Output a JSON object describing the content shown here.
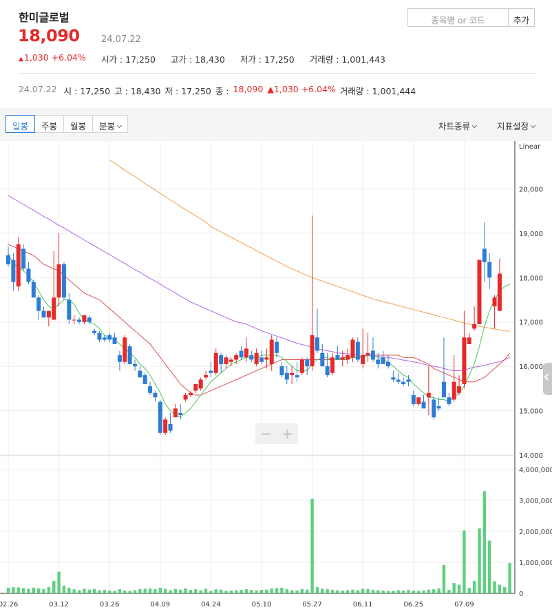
{
  "header": {
    "stock_name": "한미글로벌",
    "price": "18,090",
    "date": "24.07.22",
    "change": "1,030 +6.04%",
    "open": "시가 : 17,250",
    "high": "고가 : 18,430",
    "low": "저가 : 17,250",
    "volume": "거래량 : 1,001,443"
  },
  "search": {
    "placeholder": "종목명 or 코드",
    "add_label": "추가"
  },
  "day_summary": {
    "date": "24.07.22",
    "open": "시 : 17,250",
    "high": "고 : 18,430",
    "low": "저 : 17,250",
    "close_label": "종 :",
    "close": "18,090",
    "change": "1,030 +6.04%",
    "volume": "거래량 : 1,001,444"
  },
  "toolbar": {
    "tabs": [
      "일봉",
      "주봉",
      "월봉",
      "분봉"
    ],
    "active_tab": "일봉",
    "chart_type": "차트종류",
    "indicator": "지표설정"
  },
  "colors": {
    "up": "#e52a2a",
    "down": "#2d7dd6",
    "volume": "#5fcf80",
    "ma5": "#4cc45a",
    "ma20": "#e05050",
    "ma60": "#b266e0",
    "ma120": "#f0a050"
  },
  "chart_data": {
    "type": "candlestick",
    "scale_label": "Linear",
    "price_axis": {
      "ticks": [
        "14,000",
        "15,000",
        "16,000",
        "17,000",
        "18,000",
        "19,000",
        "20,000"
      ],
      "min": 14000,
      "max": 21000
    },
    "volume_axis": {
      "ticks": [
        "0",
        "1,000,000",
        "2,000,000",
        "3,000,000",
        "4,000,000"
      ],
      "max": 4000000
    },
    "x_ticks": [
      "02.26",
      "03.12",
      "03.26",
      "04.09",
      "04.24",
      "05.10",
      "05.27",
      "06.11",
      "06.25",
      "07.09"
    ],
    "x_tick_index": [
      0,
      10,
      20,
      30,
      40,
      50,
      60,
      70,
      80,
      90
    ],
    "candles": [
      [
        18500,
        18700,
        18250,
        18300
      ],
      [
        18400,
        18550,
        17700,
        17900
      ],
      [
        17800,
        18900,
        17700,
        18750
      ],
      [
        18650,
        18750,
        18150,
        18200
      ],
      [
        18200,
        18350,
        17850,
        17900
      ],
      [
        17900,
        17950,
        17600,
        17550
      ],
      [
        17550,
        17600,
        17050,
        17250
      ],
      [
        17250,
        17350,
        17100,
        17100
      ],
      [
        17100,
        17200,
        16900,
        17250
      ],
      [
        17050,
        18600,
        17050,
        17550
      ],
      [
        17550,
        19000,
        17350,
        18300
      ],
      [
        18300,
        18350,
        17500,
        17550
      ],
      [
        17500,
        17650,
        16950,
        17050
      ],
      [
        17050,
        17150,
        16950,
        17050
      ],
      [
        17050,
        17100,
        16950,
        17000
      ],
      [
        17000,
        17150,
        16950,
        17150
      ],
      [
        17100,
        17150,
        16950,
        17000
      ],
      [
        16800,
        16850,
        16700,
        16750
      ],
      [
        16750,
        16800,
        16550,
        16600
      ],
      [
        16650,
        16700,
        16550,
        16600
      ],
      [
        16700,
        16750,
        16550,
        16600
      ],
      [
        16650,
        16750,
        16500,
        16500
      ],
      [
        16250,
        16350,
        15900,
        16100
      ],
      [
        16100,
        16700,
        16050,
        16650
      ],
      [
        16450,
        16500,
        16050,
        16050
      ],
      [
        16050,
        16150,
        15900,
        16000
      ],
      [
        15900,
        16000,
        15750,
        15750
      ],
      [
        15800,
        15850,
        15600,
        15600
      ],
      [
        15550,
        15650,
        15350,
        15400
      ],
      [
        15400,
        15450,
        15200,
        15300
      ],
      [
        15200,
        15250,
        14450,
        14500
      ],
      [
        14500,
        14850,
        14450,
        14800
      ],
      [
        14700,
        14950,
        14500,
        14550
      ],
      [
        14850,
        15150,
        14950,
        15050
      ],
      [
        14950,
        15150,
        14800,
        14900
      ],
      [
        15250,
        15400,
        15200,
        15350
      ],
      [
        15350,
        15450,
        15300,
        15400
      ],
      [
        15450,
        15550,
        15400,
        15600
      ],
      [
        15500,
        15750,
        15450,
        15700
      ],
      [
        15750,
        15900,
        15700,
        15800
      ],
      [
        15900,
        16100,
        15750,
        15850
      ],
      [
        15850,
        16400,
        15800,
        16300
      ],
      [
        16250,
        16300,
        15850,
        16050
      ],
      [
        16050,
        16250,
        15950,
        16200
      ],
      [
        16100,
        16200,
        16000,
        16150
      ],
      [
        16150,
        16300,
        16050,
        16250
      ],
      [
        16350,
        16450,
        16150,
        16200
      ],
      [
        16200,
        16650,
        16100,
        16400
      ],
      [
        16250,
        16350,
        16100,
        16150
      ],
      [
        16050,
        16400,
        16000,
        16300
      ],
      [
        16200,
        16350,
        16050,
        16100
      ],
      [
        16150,
        16400,
        15950,
        16200
      ],
      [
        16050,
        16700,
        15900,
        16600
      ],
      [
        16550,
        16650,
        16200,
        16300
      ],
      [
        16000,
        16100,
        15750,
        15800
      ],
      [
        15850,
        16000,
        15600,
        15700
      ],
      [
        15800,
        16000,
        15600,
        15850
      ],
      [
        15800,
        16100,
        15650,
        15750
      ],
      [
        15850,
        16200,
        15800,
        16150
      ],
      [
        16150,
        16200,
        15800,
        16000
      ],
      [
        16000,
        19400,
        15900,
        16700
      ],
      [
        16650,
        17300,
        16300,
        16350
      ],
      [
        16300,
        16500,
        16100,
        16000
      ],
      [
        16000,
        16300,
        15750,
        15800
      ],
      [
        15850,
        16300,
        15800,
        16200
      ],
      [
        16250,
        16450,
        16150,
        16150
      ],
      [
        16150,
        16350,
        16000,
        16200
      ],
      [
        16150,
        16400,
        16050,
        16250
      ],
      [
        16200,
        16650,
        16100,
        16600
      ],
      [
        16550,
        16650,
        16100,
        16150
      ],
      [
        16050,
        16850,
        15950,
        16250
      ],
      [
        16250,
        16750,
        16100,
        16300
      ],
      [
        16350,
        16650,
        16100,
        16150
      ],
      [
        16150,
        16300,
        15950,
        16050
      ],
      [
        16200,
        16350,
        16050,
        16050
      ],
      [
        16100,
        16250,
        15950,
        16000
      ],
      [
        15750,
        15900,
        15650,
        15700
      ],
      [
        15700,
        15850,
        15600,
        15650
      ],
      [
        15650,
        15750,
        15550,
        15600
      ],
      [
        15700,
        15800,
        15550,
        15650
      ],
      [
        15350,
        15450,
        15100,
        15150
      ],
      [
        15150,
        15300,
        15100,
        15300
      ],
      [
        15200,
        15350,
        15050,
        15050
      ],
      [
        15300,
        16000,
        14900,
        15400
      ],
      [
        15250,
        15300,
        14800,
        14850
      ],
      [
        15100,
        15300,
        15000,
        15050
      ],
      [
        15650,
        16650,
        15350,
        15300
      ],
      [
        15300,
        15400,
        15100,
        15150
      ],
      [
        15250,
        16250,
        15200,
        15650
      ],
      [
        15400,
        15800,
        15350,
        15550
      ],
      [
        15600,
        17250,
        15500,
        16650
      ],
      [
        16500,
        16750,
        16550,
        16650
      ],
      [
        16850,
        17350,
        16800,
        16950
      ],
      [
        16950,
        18400,
        16950,
        18400
      ],
      [
        18650,
        19250,
        17900,
        18350
      ],
      [
        18350,
        18550,
        17750,
        18000
      ],
      [
        17350,
        17600,
        16850,
        17550
      ],
      [
        17250,
        18430,
        17250,
        18090
      ]
    ],
    "volumes": [
      180000,
      200000,
      190000,
      170000,
      150000,
      180000,
      160000,
      140000,
      200000,
      400000,
      700000,
      250000,
      180000,
      130000,
      100000,
      150000,
      120000,
      140000,
      100000,
      110000,
      90000,
      80000,
      130000,
      90000,
      80000,
      100000,
      140000,
      150000,
      160000,
      140000,
      180000,
      150000,
      100000,
      140000,
      120000,
      160000,
      110000,
      130000,
      100000,
      150000,
      80000,
      130000,
      120000,
      80000,
      90000,
      100000,
      110000,
      130000,
      110000,
      90000,
      110000,
      120000,
      160000,
      170000,
      180000,
      140000,
      100000,
      90000,
      140000,
      120000,
      3050000,
      200000,
      150000,
      130000,
      110000,
      100000,
      90000,
      100000,
      120000,
      100000,
      150000,
      140000,
      110000,
      100000,
      90000,
      80000,
      80000,
      100000,
      90000,
      110000,
      90000,
      80000,
      90000,
      120000,
      130000,
      160000,
      910000,
      110000,
      330000,
      280000,
      2030000,
      170000,
      400000,
      2100000,
      3300000,
      1700000,
      390000,
      280000,
      200000,
      980000
    ],
    "ma5": [
      18550,
      18300,
      18250,
      18150,
      18050,
      17900,
      17700,
      17500,
      17350,
      17300,
      17400,
      17500,
      17500,
      17400,
      17200,
      17050,
      17000,
      16950,
      16850,
      16700,
      16650,
      16600,
      16500,
      16400,
      16300,
      16200,
      16050,
      15950,
      15800,
      15600,
      15400,
      15150,
      15000,
      14900,
      14850,
      14950,
      15050,
      15200,
      15350,
      15500,
      15650,
      15750,
      15850,
      15950,
      16050,
      16100,
      16150,
      16200,
      16200,
      16200,
      16250,
      16250,
      16250,
      16250,
      16200,
      16100,
      16000,
      15900,
      15900,
      15900,
      16050,
      16150,
      16200,
      16200,
      16150,
      16150,
      16150,
      16150,
      16200,
      16200,
      16200,
      16250,
      16250,
      16200,
      16150,
      16100,
      16000,
      15900,
      15800,
      15750,
      15600,
      15500,
      15400,
      15300,
      15300,
      15250,
      15250,
      15200,
      15300,
      15400,
      15550,
      15800,
      16050,
      16450,
      16900,
      17250,
      17500,
      17700,
      17800,
      17850
    ],
    "ma20": [
      18750,
      18700,
      18650,
      18600,
      18550,
      18500,
      18400,
      18300,
      18250,
      18200,
      18150,
      18050,
      17950,
      17850,
      17750,
      17650,
      17600,
      17550,
      17500,
      17400,
      17300,
      17200,
      17100,
      17000,
      16900,
      16800,
      16700,
      16600,
      16500,
      16350,
      16200,
      16050,
      15900,
      15750,
      15600,
      15500,
      15400,
      15350,
      15350,
      15400,
      15450,
      15500,
      15550,
      15600,
      15650,
      15700,
      15750,
      15800,
      15850,
      15900,
      15950,
      16000,
      16050,
      16100,
      16150,
      16150,
      16150,
      16150,
      16150,
      16150,
      16150,
      16150,
      16150,
      16150,
      16150,
      16150,
      16200,
      16200,
      16200,
      16200,
      16250,
      16250,
      16250,
      16250,
      16250,
      16250,
      16250,
      16250,
      16200,
      16200,
      16200,
      16150,
      16100,
      16050,
      15950,
      15900,
      15850,
      15800,
      15750,
      15700,
      15650,
      15650,
      15650,
      15700,
      15750,
      15850,
      15950,
      16050,
      16150,
      16300
    ],
    "ma60": [
      19850,
      19780,
      19720,
      19650,
      19580,
      19520,
      19450,
      19380,
      19320,
      19250,
      19180,
      19120,
      19050,
      18980,
      18920,
      18850,
      18780,
      18720,
      18650,
      18580,
      18520,
      18450,
      18380,
      18320,
      18250,
      18180,
      18120,
      18050,
      17980,
      17920,
      17850,
      17780,
      17720,
      17650,
      17580,
      17520,
      17450,
      17400,
      17350,
      17300,
      17250,
      17200,
      17150,
      17100,
      17050,
      17000,
      16980,
      16950,
      16900,
      16850,
      16800,
      16760,
      16720,
      16680,
      16640,
      16600,
      16560,
      16520,
      16490,
      16460,
      16430,
      16400,
      16370,
      16350,
      16330,
      16300,
      16290,
      16280,
      16270,
      16260,
      16250,
      16240,
      16230,
      16220,
      16210,
      16200,
      16180,
      16160,
      16140,
      16120,
      16100,
      16080,
      16050,
      16020,
      16000,
      15980,
      15950,
      15920,
      15900,
      15900,
      15920,
      15950,
      15980,
      16000,
      16020,
      16050,
      16080,
      16100,
      16150,
      16200
    ],
    "ma120": [
      null,
      null,
      null,
      null,
      null,
      null,
      null,
      null,
      null,
      null,
      null,
      null,
      null,
      null,
      null,
      null,
      null,
      null,
      null,
      null,
      20650,
      20580,
      20500,
      20420,
      20350,
      20280,
      20200,
      20120,
      20050,
      19980,
      19900,
      19830,
      19750,
      19680,
      19600,
      19530,
      19460,
      19390,
      19320,
      19250,
      19150,
      19090,
      19030,
      18970,
      18910,
      18850,
      18790,
      18730,
      18670,
      18610,
      18550,
      18490,
      18430,
      18370,
      18310,
      18250,
      18200,
      18150,
      18100,
      18050,
      18000,
      17960,
      17920,
      17880,
      17840,
      17800,
      17760,
      17720,
      17680,
      17640,
      17600,
      17560,
      17520,
      17490,
      17460,
      17430,
      17400,
      17370,
      17340,
      17310,
      17280,
      17250,
      17220,
      17190,
      17160,
      17130,
      17100,
      17070,
      17040,
      17010,
      16980,
      16950,
      16920,
      16900,
      16880,
      16860,
      16840,
      16820,
      16800,
      16790
    ]
  }
}
